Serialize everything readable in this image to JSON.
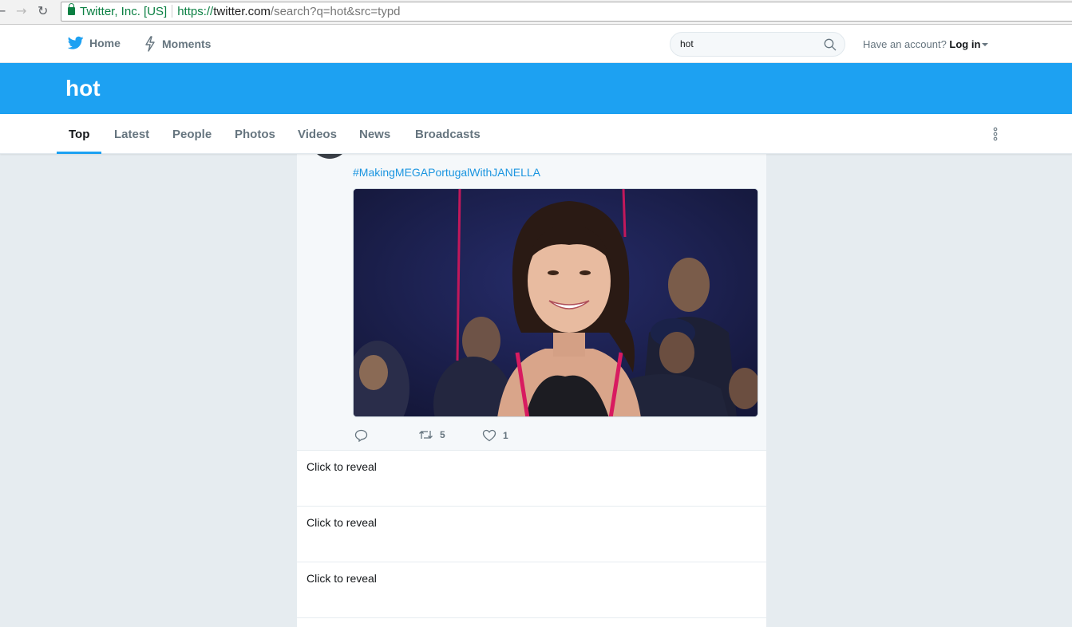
{
  "browser": {
    "cert_label": "Twitter, Inc. [US]",
    "url_scheme": "https://",
    "url_host": "twitter.com",
    "url_path": "/search?q=hot&src=typd",
    "icons": [
      "back-arrow-icon",
      "forward-arrow-icon",
      "reload-icon",
      "lock-icon"
    ]
  },
  "topnav": {
    "home_label": "Home",
    "moments_label": "Moments",
    "search_value": "hot",
    "account_prompt": "Have an account?",
    "login_label": "Log in"
  },
  "header": {
    "query": "hot"
  },
  "tabs": [
    {
      "label": "Top",
      "active": true
    },
    {
      "label": "Latest",
      "active": false
    },
    {
      "label": "People",
      "active": false
    },
    {
      "label": "Photos",
      "active": false
    },
    {
      "label": "Videos",
      "active": false
    },
    {
      "label": "News",
      "active": false
    },
    {
      "label": "Broadcasts",
      "active": false
    }
  ],
  "tweet": {
    "hashtag": "#MakingMEGAPortugalWithJANELLA",
    "retweet_count": "5",
    "like_count": "1"
  },
  "hidden_tweets": [
    {
      "label": "Click to reveal"
    },
    {
      "label": "Click to reveal"
    },
    {
      "label": "Click to reveal"
    }
  ],
  "colors": {
    "brand_blue": "#1da1f2",
    "link_blue": "#1b95e0",
    "page_bg": "#e6ecf0",
    "muted_text": "#66757f"
  }
}
